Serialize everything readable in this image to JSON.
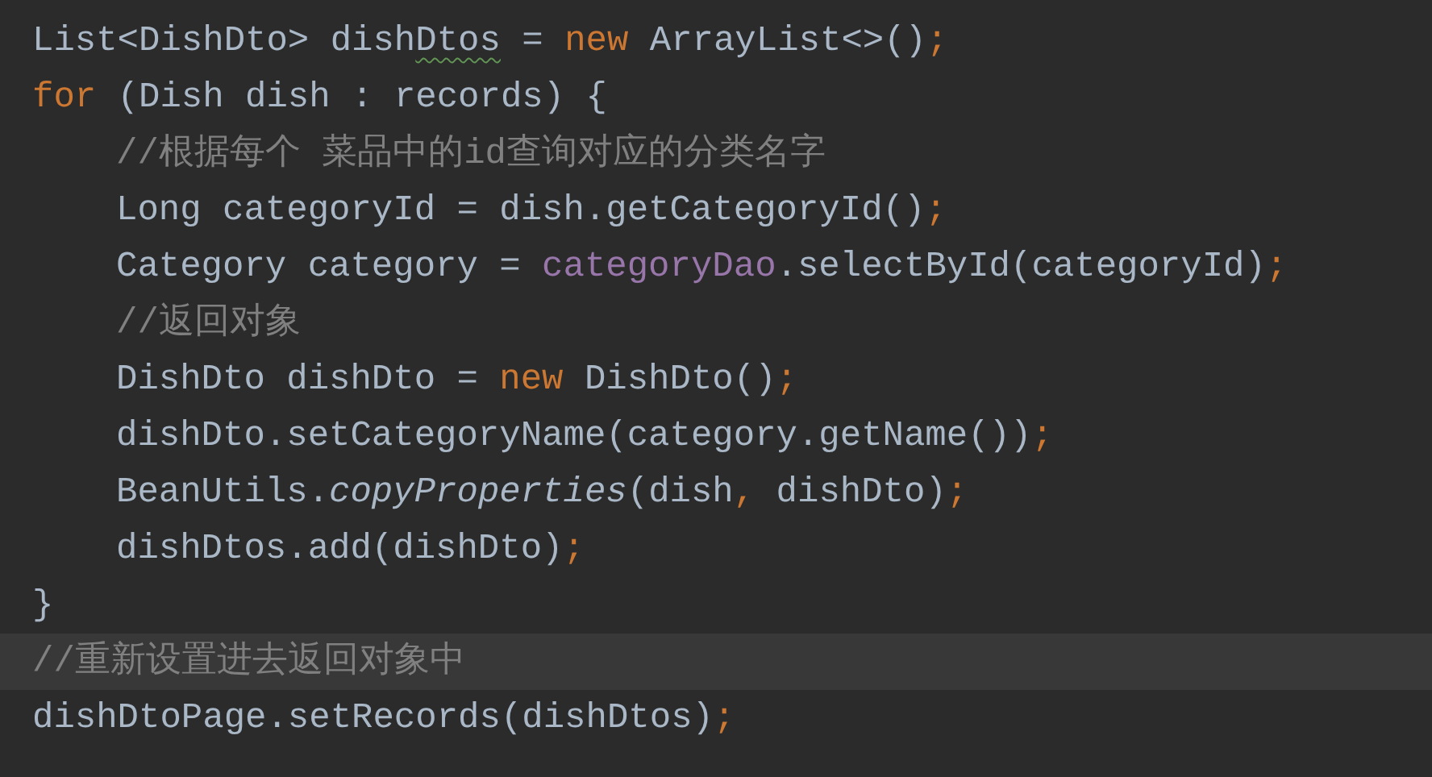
{
  "editor": {
    "lines": [
      {
        "current": false,
        "tokens": [
          {
            "text": "List<DishDto> dish",
            "kind": "text"
          },
          {
            "text": "Dtos",
            "kind": "warning"
          },
          {
            "text": " = ",
            "kind": "text"
          },
          {
            "text": "new",
            "kind": "keyword"
          },
          {
            "text": " ArrayList<>()",
            "kind": "text"
          },
          {
            "text": ";",
            "kind": "keyword"
          }
        ]
      },
      {
        "current": false,
        "tokens": [
          {
            "text": "for",
            "kind": "keyword"
          },
          {
            "text": " (Dish dish : records) {",
            "kind": "text"
          }
        ],
        "children": [
          {
            "current": false,
            "tokens": [
              {
                "text": "//根据每个 菜品中的id查询对应的分类名字",
                "kind": "comment"
              }
            ]
          },
          {
            "current": false,
            "tokens": [
              {
                "text": "Long categoryId = dish.getCategoryId()",
                "kind": "text"
              },
              {
                "text": ";",
                "kind": "keyword"
              }
            ]
          },
          {
            "current": false,
            "tokens": [
              {
                "text": "Category category = ",
                "kind": "text"
              },
              {
                "text": "categoryDao",
                "kind": "field"
              },
              {
                "text": ".selectById(categoryId)",
                "kind": "text"
              },
              {
                "text": ";",
                "kind": "keyword"
              }
            ]
          },
          {
            "current": false,
            "tokens": [
              {
                "text": "//返回对象",
                "kind": "comment"
              }
            ]
          },
          {
            "current": false,
            "tokens": [
              {
                "text": "DishDto dishDto = ",
                "kind": "text"
              },
              {
                "text": "new",
                "kind": "keyword"
              },
              {
                "text": " DishDto()",
                "kind": "text"
              },
              {
                "text": ";",
                "kind": "keyword"
              }
            ]
          },
          {
            "current": false,
            "tokens": [
              {
                "text": "dishDto.setCategoryName(category.getName())",
                "kind": "text"
              },
              {
                "text": ";",
                "kind": "keyword"
              }
            ]
          },
          {
            "current": false,
            "tokens": [
              {
                "text": "BeanUtils.",
                "kind": "text"
              },
              {
                "text": "copyProperties",
                "kind": "static"
              },
              {
                "text": "(dish",
                "kind": "text"
              },
              {
                "text": ",",
                "kind": "keyword"
              },
              {
                "text": " dishDto)",
                "kind": "text"
              },
              {
                "text": ";",
                "kind": "keyword"
              }
            ]
          },
          {
            "current": false,
            "tokens": [
              {
                "text": "dishDtos.add(dishDto)",
                "kind": "text"
              },
              {
                "text": ";",
                "kind": "keyword"
              }
            ]
          }
        ]
      },
      {
        "current": false,
        "tokens": [
          {
            "text": "}",
            "kind": "text"
          }
        ]
      },
      {
        "current": true,
        "tokens": [
          {
            "text": "//重新设置进去返回对象中",
            "kind": "comment"
          }
        ]
      },
      {
        "current": false,
        "tokens": [
          {
            "text": "dishDtoPage.setRecords(dishDtos)",
            "kind": "text"
          },
          {
            "text": ";",
            "kind": "keyword"
          }
        ]
      }
    ]
  }
}
